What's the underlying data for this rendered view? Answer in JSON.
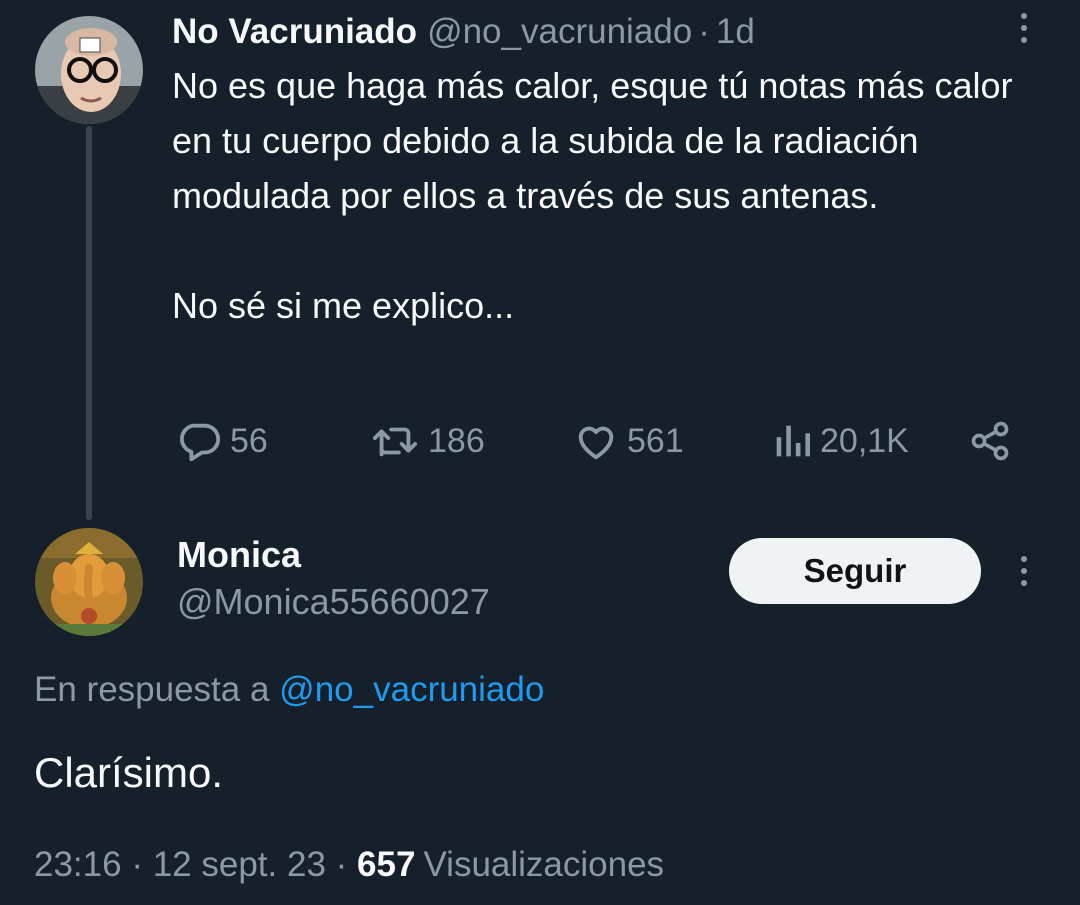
{
  "parent": {
    "name": "No Vacruniado",
    "handle": "@no_vacruniado",
    "separator": "·",
    "time": "1d",
    "text_p1": "No es que haga más calor, esque tú notas más calor en tu cuerpo debido a la subida de la radiación modulada por ellos a través de sus antenas.",
    "text_p2": "No sé si me explico...",
    "actions": {
      "replies": "56",
      "retweets": "186",
      "likes": "561",
      "views": "20,1K"
    },
    "avatar_icon": "avatar-man-glasses-icon"
  },
  "reply": {
    "name": "Monica",
    "handle": "@Monica55660027",
    "follow_label": "Seguir",
    "context_prefix": "En respuesta a",
    "context_mention": "@no_vacruniado",
    "text": "Clarísimo.",
    "meta_time": "23:16",
    "meta_sep": "·",
    "meta_date": "12 sept. 23",
    "meta_views_count": "657",
    "meta_views_label": "Visualizaciones",
    "avatar_icon": "avatar-ganesha-icon"
  },
  "colors": {
    "background": "#15202b",
    "text": "#f7f9f9",
    "muted": "#8b98a5",
    "link": "#1d9bf0",
    "button_bg": "#eff3f4"
  }
}
